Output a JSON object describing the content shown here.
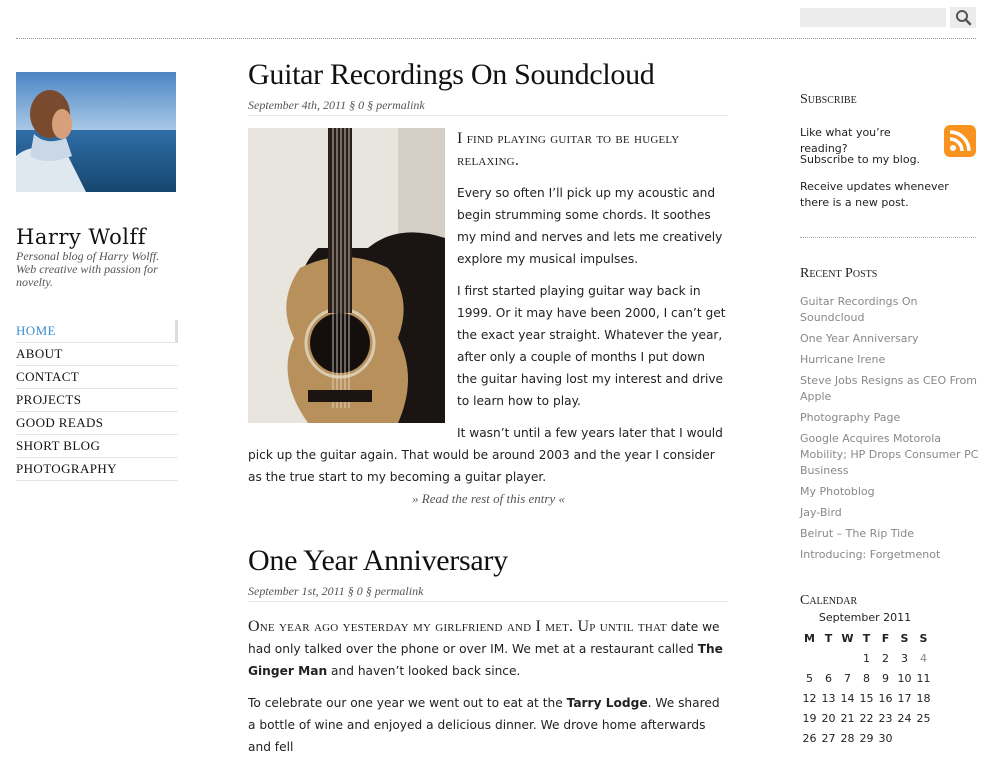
{
  "search": {
    "placeholder": ""
  },
  "site": {
    "title": "Harry Wolff",
    "tagline": "Personal blog of Harry Wolff. Web creative with passion for novelty."
  },
  "nav": [
    "HOME",
    "ABOUT",
    "CONTACT",
    "PROJECTS",
    "GOOD READS",
    "SHORT BLOG",
    "PHOTOGRAPHY"
  ],
  "posts": [
    {
      "title": "Guitar Recordings On Soundcloud",
      "meta": "September 4th, 2011 § 0 § permalink",
      "lead": "I find playing guitar to be hugely relaxing.",
      "p1": "Every so often I’ll pick up my acoustic and begin strumming some chords. It soothes my mind and nerves and lets me creatively explore my musical impulses.",
      "p2": "I first started playing guitar way back in 1999. Or it may have been 2000, I can’t get the exact year straight. Whatever the year, after only a couple of months I put down the guitar having lost my interest and drive to learn how to play.",
      "p3": "It wasn’t until a few years later that I would pick up the guitar again. That would be around 2003 and the year I consider as the true start to my becoming a guitar player.",
      "read_more": "» Read the rest of this entry «"
    },
    {
      "title": "One Year Anniversary",
      "meta": "September 1st, 2011 § 0 § permalink",
      "lead": "One year ago yesterday my girlfriend and I met. Up until that",
      "p1_a": " date we had only talked over the phone or over IM. We met at a restaurant called ",
      "p1_bold": "The Ginger Man",
      "p1_b": " and haven’t looked back since.",
      "p2_a": "To celebrate our one year we went out to eat at the ",
      "p2_bold": "Tarry Lodge",
      "p2_b": ". We shared a bottle of wine and enjoyed a delicious dinner. We drove home afterwards and fell"
    }
  ],
  "sidebar": {
    "subscribe": {
      "title": "Subscribe",
      "line1": "Like what you’re reading?",
      "line2": "Subscribe to my blog.",
      "line3": "Receive updates whenever there is a new post."
    },
    "recent": {
      "title": "Recent Posts",
      "items": [
        "Guitar Recordings On Soundcloud",
        "One Year Anniversary",
        "Hurricane Irene",
        "Steve Jobs Resigns as CEO From Apple",
        "Photography Page",
        "Google Acquires Motorola Mobility; HP Drops Consumer PC Business",
        "My Photoblog",
        "Jay-Bird",
        "Beirut – The Rip Tide",
        "Introducing: Forgetmenot"
      ]
    },
    "calendar": {
      "title": "Calendar",
      "caption": "September 2011",
      "days": [
        "M",
        "T",
        "W",
        "T",
        "F",
        "S",
        "S"
      ],
      "rows": [
        [
          "",
          "",
          "",
          "1",
          "2",
          "3",
          "4"
        ],
        [
          "5",
          "6",
          "7",
          "8",
          "9",
          "10",
          "11"
        ],
        [
          "12",
          "13",
          "14",
          "15",
          "16",
          "17",
          "18"
        ],
        [
          "19",
          "20",
          "21",
          "22",
          "23",
          "24",
          "25"
        ],
        [
          "26",
          "27",
          "28",
          "29",
          "30",
          "",
          ""
        ]
      ]
    }
  },
  "colors": {
    "accent": "#3b8fd4",
    "rss": "#f7931e"
  }
}
